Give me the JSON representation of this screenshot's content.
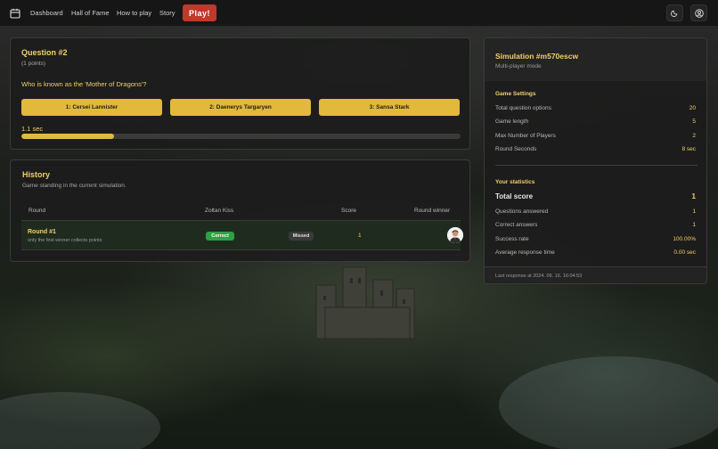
{
  "nav": {
    "links": [
      "Dashboard",
      "Hall of Fame",
      "How to play",
      "Story"
    ],
    "play_label": "Play!",
    "theme_icon": "moon-icon",
    "account_icon": "user-circle-icon"
  },
  "question": {
    "title": "Question #2",
    "points": "(1 points)",
    "text": "Who is known as the 'Mother of Dragons'?",
    "options": [
      "1: Cersei Lannister",
      "2: Daenerys Targaryen",
      "3: Sansa Stark"
    ],
    "timer_label": "1.1 sec",
    "progress_fraction": 0.21
  },
  "history": {
    "title": "History",
    "subtitle": "Game standing in the current simulation.",
    "columns": [
      "Round",
      "Zoltan Kiss",
      "Score",
      "Round winner"
    ],
    "rows": [
      {
        "round": "Round #1",
        "note": "only the first winner collects points",
        "player_status": "Correct",
        "status2": "Missed",
        "score": "1"
      }
    ]
  },
  "simulation": {
    "title": "Simulation #m570escw",
    "mode": "Multi-player mode",
    "settings_title": "Game Settings",
    "settings": [
      {
        "label": "Total question options",
        "value": "20"
      },
      {
        "label": "Game length",
        "value": "5"
      },
      {
        "label": "Max Number of Players",
        "value": "2"
      },
      {
        "label": "Round Seconds",
        "value": "8 sec"
      }
    ],
    "stats_title": "Your statistics",
    "stats": [
      {
        "label": "Total score",
        "value": "1"
      },
      {
        "label": "Questions answered",
        "value": "1"
      },
      {
        "label": "Correct answers",
        "value": "1"
      },
      {
        "label": "Success rate",
        "value": "100.00%"
      },
      {
        "label": "Average response time",
        "value": "0.00 sec"
      }
    ],
    "footer": "Last response at 2024. 09. 16. 16:04:53"
  },
  "colors": {
    "accent": "#e2b93b",
    "play": "#c0392b",
    "correct": "#2ea043"
  }
}
